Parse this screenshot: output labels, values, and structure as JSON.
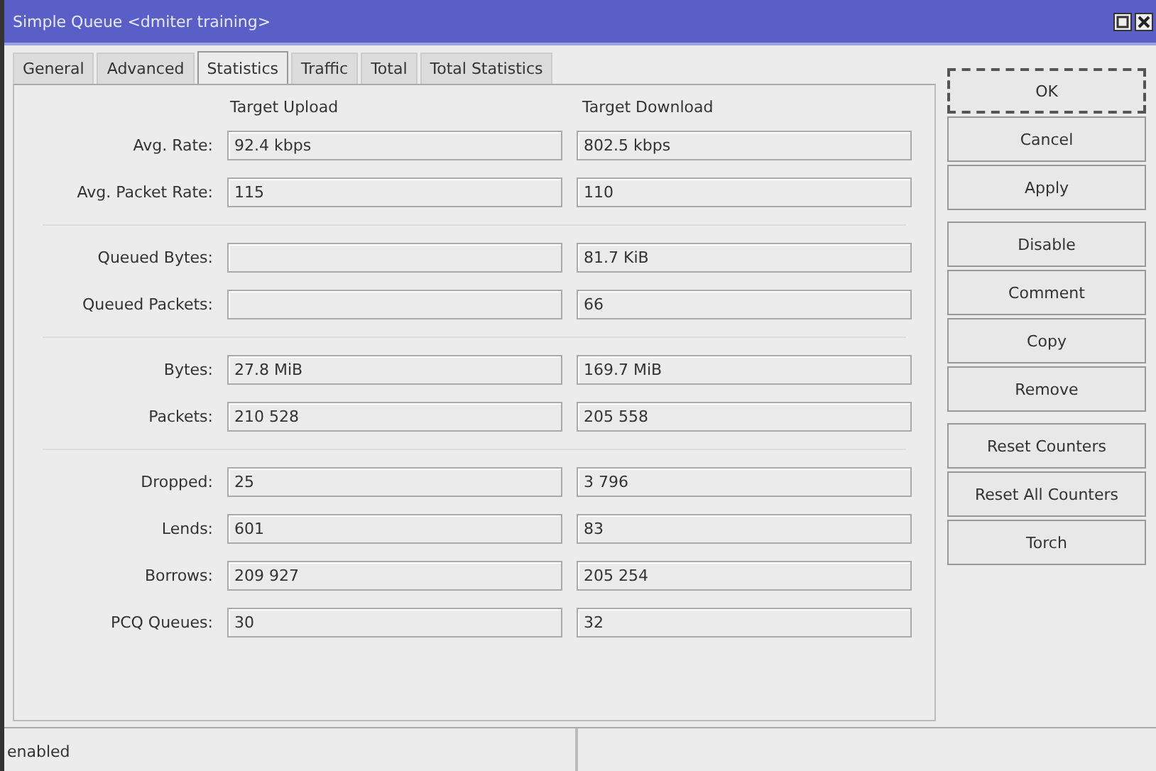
{
  "window": {
    "title": "Simple Queue <dmiter training>"
  },
  "tabs": [
    {
      "label": "General",
      "selected": false
    },
    {
      "label": "Advanced",
      "selected": false
    },
    {
      "label": "Statistics",
      "selected": true
    },
    {
      "label": "Traffic",
      "selected": false
    },
    {
      "label": "Total",
      "selected": false
    },
    {
      "label": "Total Statistics",
      "selected": false
    }
  ],
  "columns": [
    "Target Upload",
    "Target Download"
  ],
  "groups": [
    {
      "rows": [
        {
          "label": "Avg. Rate:",
          "upload": "92.4 kbps",
          "download": "802.5 kbps"
        },
        {
          "label": "Avg. Packet Rate:",
          "upload": "115",
          "download": "110"
        }
      ]
    },
    {
      "rows": [
        {
          "label": "Queued Bytes:",
          "download": "81.7 KiB"
        },
        {
          "label": "Queued Packets:",
          "download": "66"
        }
      ]
    },
    {
      "rows": [
        {
          "label": "Bytes:",
          "upload": "27.8 MiB",
          "download": "169.7 MiB"
        },
        {
          "label": "Packets:",
          "upload": "210 528",
          "download": "205 558"
        }
      ]
    },
    {
      "rows": [
        {
          "label": "Dropped:",
          "upload": "25",
          "download": "3 796"
        },
        {
          "label": "Lends:",
          "upload": "601",
          "download": "83"
        },
        {
          "label": "Borrows:",
          "upload": "209 927",
          "download": "205 254"
        },
        {
          "label": "PCQ Queues:",
          "upload": "30",
          "download": "32"
        }
      ]
    }
  ],
  "button_groups": [
    [
      {
        "label": "OK",
        "default": true
      },
      {
        "label": "Cancel",
        "default": false
      },
      {
        "label": "Apply",
        "default": false
      }
    ],
    [
      {
        "label": "Disable",
        "default": false
      },
      {
        "label": "Comment",
        "default": false
      },
      {
        "label": "Copy",
        "default": false
      },
      {
        "label": "Remove",
        "default": false
      }
    ],
    [
      {
        "label": "Reset Counters",
        "default": false
      },
      {
        "label": "Reset All Counters",
        "default": false
      },
      {
        "label": "Torch",
        "default": false
      }
    ]
  ],
  "status_bar": {
    "status": "enabled"
  }
}
